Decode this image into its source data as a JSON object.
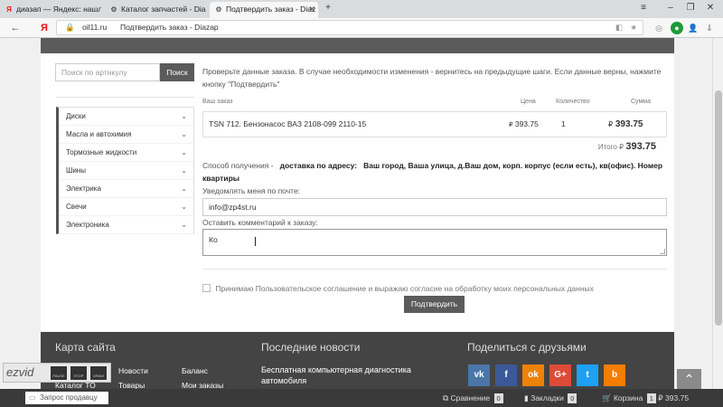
{
  "tabs": [
    {
      "title": "диазап — Яндекс: нашлось",
      "icon": "yandex-icon"
    },
    {
      "title": "Каталог запчастей - Diazap",
      "icon": "diazap-icon"
    },
    {
      "title": "Подтвердить заказ - Diaz",
      "icon": "diazap-icon",
      "active": true
    }
  ],
  "browser": {
    "domain": "oil11.ru",
    "page_title": "Подтвердить заказ - Diazap",
    "logo": "Я"
  },
  "sidebar": {
    "search_placeholder": "Поиск по артикулу",
    "search_button": "Поиск",
    "categories": [
      "Диски",
      "Масла и автохимия",
      "Тормозные жидкости",
      "Шины",
      "Электрика",
      "Свечи",
      "Электроника"
    ]
  },
  "checkout": {
    "notice": "Проверьте данные заказа. В случае необходимости изменения - вернитесь на предыдущие шаги. Если данные верны, нажмите кнопку \"Подтвердить\"",
    "headers": {
      "order": "Ваш заказ",
      "price": "Цена",
      "qty": "Количество",
      "sum": "Сумма"
    },
    "item": {
      "name": "TSN 712. Бензонасос ВАЗ 2108-099 2110-15",
      "price": "393.75",
      "qty": "1",
      "sum": "393.75"
    },
    "currency": "₽",
    "total_label": "Итого",
    "total_value": "393.75",
    "delivery_label": "Способ получения -",
    "delivery_method": "доставка по адресу:",
    "delivery_address": "Ваш город, Ваша улица, д.Ваш дом, корп. корпус (если есть), кв(офис). Номер квартиры",
    "email_label": "Уведомлять меня по почте:",
    "email_value": "info@zp4st.ru",
    "comment_label": "Оставить комментарий к заказу:",
    "comment_value": "Ко",
    "agree_prefix": "Принимаю",
    "agree_link": "Пользовательское соглашение и выражаю согласие на обработку моих персональных данных",
    "confirm_button": "Подтвердить"
  },
  "footer": {
    "sitemap_title": "Карта сайта",
    "news_title": "Последние новости",
    "share_title": "Поделиться с друзьями",
    "links": [
      "Новости",
      "Баланс",
      "Каталог ТО",
      "Товары",
      "Мои заказы"
    ],
    "news_item": "Бесплатная компьютерная диагностика автомобиля",
    "social": [
      {
        "label": "vk",
        "color": "#4a76a8"
      },
      {
        "label": "f",
        "color": "#3b5998"
      },
      {
        "label": "ok",
        "color": "#ee8208"
      },
      {
        "label": "G+",
        "color": "#dd4b39"
      },
      {
        "label": "t",
        "color": "#1da1f2"
      },
      {
        "label": "b",
        "color": "#f57d00"
      }
    ]
  },
  "bottombar": {
    "seller_request": "Запрос продавцу",
    "compare_label": "Сравнение",
    "compare_count": "0",
    "bookmarks_label": "Закладки",
    "bookmarks_count": "0",
    "cart_label": "Корзина",
    "cart_count": "1",
    "cart_sum": "₽ 393.75"
  },
  "ezvid": {
    "logo": "ezvid",
    "buttons": [
      "PAUSE",
      "STOP",
      "DRAW"
    ]
  }
}
